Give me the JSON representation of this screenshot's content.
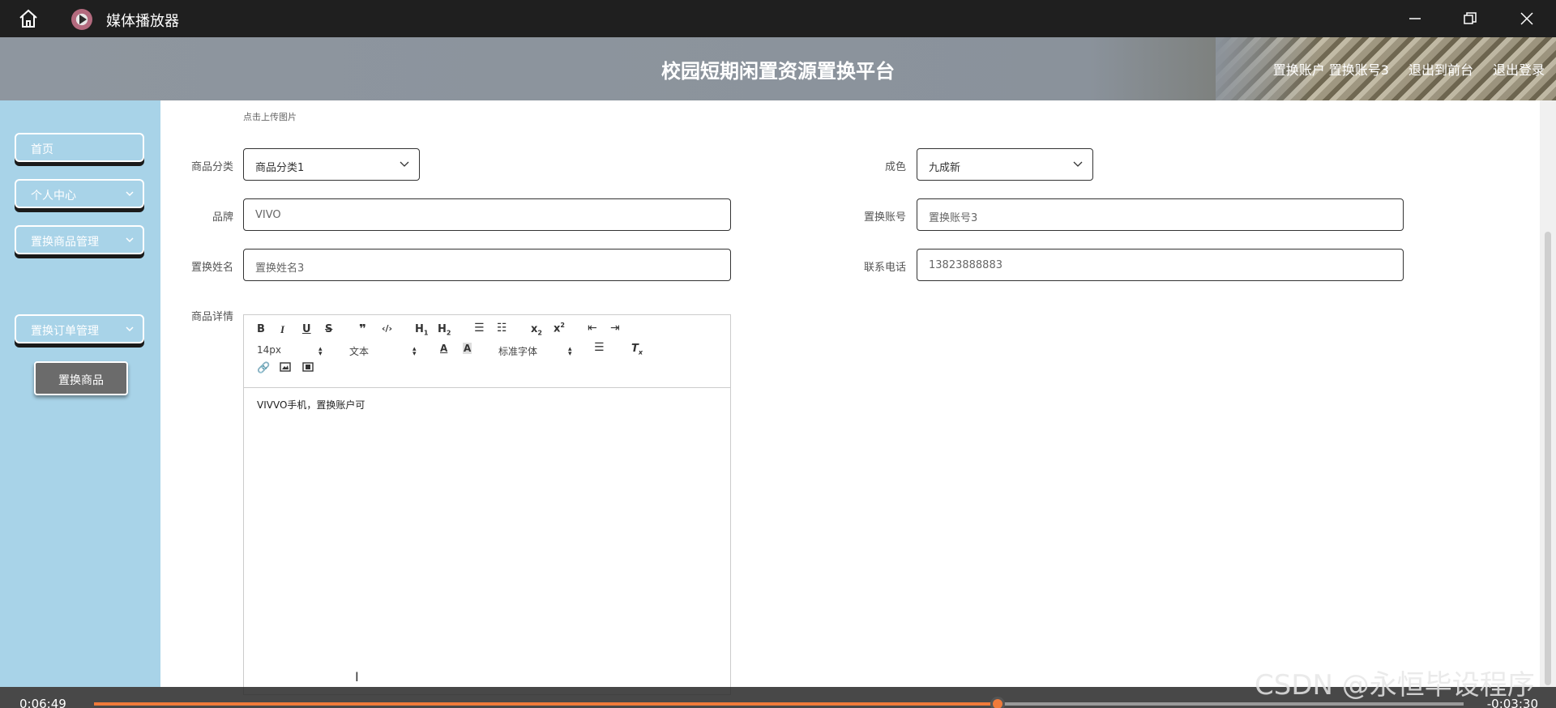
{
  "window": {
    "title": "媒体播放器"
  },
  "header": {
    "site_title": "校园短期闲置资源置换平台",
    "account_text": "置换账户 置换账号3",
    "exit_front_label": "退出到前台",
    "logout_label": "退出登录"
  },
  "sidebar": {
    "items": [
      {
        "label": "首页"
      },
      {
        "label": "个人中心"
      },
      {
        "label": "置换商品管理"
      },
      {
        "label": "置换订单管理"
      }
    ],
    "subitem_label": "置换商品"
  },
  "form": {
    "upload_hint": "点击上传图片",
    "category_label": "商品分类",
    "category_value": "商品分类1",
    "condition_label": "成色",
    "condition_value": "九成新",
    "brand_label": "品牌",
    "brand_value": "VIVO",
    "account_label": "置换账号",
    "account_value": "置换账号3",
    "name_label": "置换姓名",
    "name_value": "置换姓名3",
    "phone_label": "联系电话",
    "phone_value": "13823888883",
    "detail_label": "商品详情"
  },
  "editor": {
    "font_size": "14px",
    "paragraph": "文本",
    "font_family": "标准字体",
    "content": "VIVVO手机，置换账户可"
  },
  "player": {
    "elapsed": "0:06:49",
    "remaining": "-0:03:30",
    "progress": 0.66
  },
  "watermark": "CSDN @永恒毕设程序",
  "colors": {
    "sidebar_bg": "#a8d3e8",
    "progress_accent": "#f07a3a",
    "titlebar_bg": "#1f1f1f"
  }
}
